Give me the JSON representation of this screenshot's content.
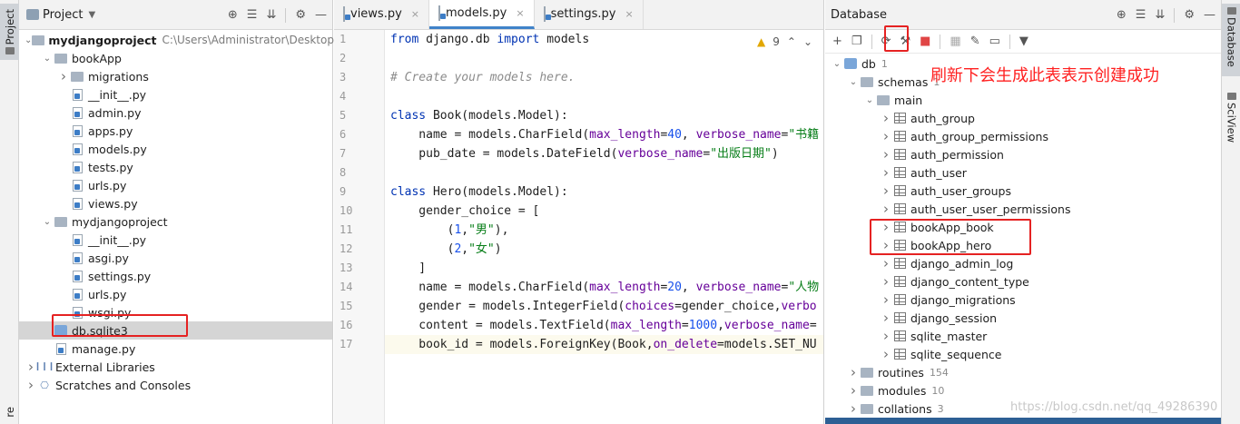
{
  "left_strip": {
    "tab_label": "Project",
    "bottom_label": "re"
  },
  "right_strip": {
    "tabs": [
      "Database",
      "SciView"
    ]
  },
  "project": {
    "header_title": "Project",
    "items": [
      {
        "depth": 0,
        "arrow": "open",
        "icon": "folder",
        "name": "mydjangoproject",
        "sub": "C:\\Users\\Administrator\\Desktop\\",
        "bold": true
      },
      {
        "depth": 1,
        "arrow": "open",
        "icon": "folder",
        "name": "bookApp"
      },
      {
        "depth": 2,
        "arrow": "closed",
        "icon": "folder",
        "name": "migrations"
      },
      {
        "depth": 2,
        "arrow": "",
        "icon": "py",
        "name": "__init__.py"
      },
      {
        "depth": 2,
        "arrow": "",
        "icon": "py",
        "name": "admin.py"
      },
      {
        "depth": 2,
        "arrow": "",
        "icon": "py",
        "name": "apps.py"
      },
      {
        "depth": 2,
        "arrow": "",
        "icon": "py",
        "name": "models.py"
      },
      {
        "depth": 2,
        "arrow": "",
        "icon": "py",
        "name": "tests.py"
      },
      {
        "depth": 2,
        "arrow": "",
        "icon": "py",
        "name": "urls.py"
      },
      {
        "depth": 2,
        "arrow": "",
        "icon": "py",
        "name": "views.py"
      },
      {
        "depth": 1,
        "arrow": "open",
        "icon": "folder",
        "name": "mydjangoproject"
      },
      {
        "depth": 2,
        "arrow": "",
        "icon": "py",
        "name": "__init__.py"
      },
      {
        "depth": 2,
        "arrow": "",
        "icon": "py",
        "name": "asgi.py"
      },
      {
        "depth": 2,
        "arrow": "",
        "icon": "py",
        "name": "settings.py"
      },
      {
        "depth": 2,
        "arrow": "",
        "icon": "py",
        "name": "urls.py"
      },
      {
        "depth": 2,
        "arrow": "",
        "icon": "py",
        "name": "wsgi.py"
      },
      {
        "depth": 1,
        "arrow": "",
        "icon": "db",
        "name": "db.sqlite3",
        "selected": true
      },
      {
        "depth": 1,
        "arrow": "",
        "icon": "py",
        "name": "manage.py"
      },
      {
        "depth": 0,
        "arrow": "closed",
        "icon": "lib",
        "name": "External Libraries"
      },
      {
        "depth": 0,
        "arrow": "closed",
        "icon": "scratch",
        "name": "Scratches and Consoles"
      }
    ]
  },
  "editor": {
    "tabs": [
      {
        "name": "views.py",
        "active": false
      },
      {
        "name": "models.py",
        "active": true
      },
      {
        "name": "settings.py",
        "active": false
      }
    ],
    "warning_count": "9",
    "line_numbers": [
      "1",
      "2",
      "3",
      "4",
      "5",
      "6",
      "7",
      "8",
      "9",
      "10",
      "11",
      "12",
      "13",
      "14",
      "15",
      "16",
      "17"
    ],
    "lines": [
      "<span class=\"kw\">from</span> django.db <span class=\"kw\">import</span> models",
      "",
      "<span class=\"cm\"># Create your models here.</span>",
      "",
      "<span class=\"kw\">class</span> Book(models.Model):",
      "    name = models.CharField(<span class=\"pa\">max_length</span>=<span class=\"nu\">40</span>, <span class=\"pa\">verbose_name</span>=<span class=\"st\">\"书籍</span>",
      "    pub_date = models.DateField(<span class=\"pa\">verbose_name</span>=<span class=\"st\">\"出版日期\"</span>)",
      "",
      "<span class=\"kw\">class</span> Hero(models.Model):",
      "    gender_choice = [",
      "        (<span class=\"nu\">1</span>,<span class=\"st\">\"男\"</span>),",
      "        (<span class=\"nu\">2</span>,<span class=\"st\">\"女\"</span>)",
      "    ]",
      "    name = models.CharField(<span class=\"pa\">max_length</span>=<span class=\"nu\">20</span>, <span class=\"pa\">verbose_name</span>=<span class=\"st\">\"人物</span>",
      "    gender = models.IntegerField(<span class=\"pa\">choices</span>=gender_choice,<span class=\"pa\">verbo</span>",
      "    content = models.TextField(<span class=\"pa\">max_length</span>=<span class=\"nu\">1000</span>,<span class=\"pa\">verbose_name</span>=",
      "    book_id = models.ForeignKey(Book,<span class=\"pa\">on_delete</span>=models.SET_NU"
    ]
  },
  "database": {
    "header_title": "Database",
    "annotation": "刷新下会生成此表表示创建成功",
    "watermark": "https://blog.csdn.net/qq_49286390",
    "items": [
      {
        "depth": 0,
        "arrow": "open",
        "icon": "db",
        "name": "db",
        "count": "1"
      },
      {
        "depth": 1,
        "arrow": "open",
        "icon": "folder",
        "name": "schemas",
        "count": "1"
      },
      {
        "depth": 2,
        "arrow": "open",
        "icon": "folder",
        "name": "main"
      },
      {
        "depth": 3,
        "arrow": "closed",
        "icon": "table",
        "name": "auth_group"
      },
      {
        "depth": 3,
        "arrow": "closed",
        "icon": "table",
        "name": "auth_group_permissions"
      },
      {
        "depth": 3,
        "arrow": "closed",
        "icon": "table",
        "name": "auth_permission"
      },
      {
        "depth": 3,
        "arrow": "closed",
        "icon": "table",
        "name": "auth_user"
      },
      {
        "depth": 3,
        "arrow": "closed",
        "icon": "table",
        "name": "auth_user_groups"
      },
      {
        "depth": 3,
        "arrow": "closed",
        "icon": "table",
        "name": "auth_user_user_permissions"
      },
      {
        "depth": 3,
        "arrow": "closed",
        "icon": "table",
        "name": "bookApp_book"
      },
      {
        "depth": 3,
        "arrow": "closed",
        "icon": "table",
        "name": "bookApp_hero"
      },
      {
        "depth": 3,
        "arrow": "closed",
        "icon": "table",
        "name": "django_admin_log"
      },
      {
        "depth": 3,
        "arrow": "closed",
        "icon": "table",
        "name": "django_content_type"
      },
      {
        "depth": 3,
        "arrow": "closed",
        "icon": "table",
        "name": "django_migrations"
      },
      {
        "depth": 3,
        "arrow": "closed",
        "icon": "table",
        "name": "django_session"
      },
      {
        "depth": 3,
        "arrow": "closed",
        "icon": "table",
        "name": "sqlite_master"
      },
      {
        "depth": 3,
        "arrow": "closed",
        "icon": "table",
        "name": "sqlite_sequence"
      },
      {
        "depth": 1,
        "arrow": "closed",
        "icon": "folder",
        "name": "routines",
        "count": "154"
      },
      {
        "depth": 1,
        "arrow": "closed",
        "icon": "folder",
        "name": "modules",
        "count": "10"
      },
      {
        "depth": 1,
        "arrow": "closed",
        "icon": "folder",
        "name": "collations",
        "count": "3"
      }
    ]
  },
  "colors": {
    "accent": "#4083c9",
    "highlight": "#e52222",
    "annotation": "#ff2020"
  }
}
